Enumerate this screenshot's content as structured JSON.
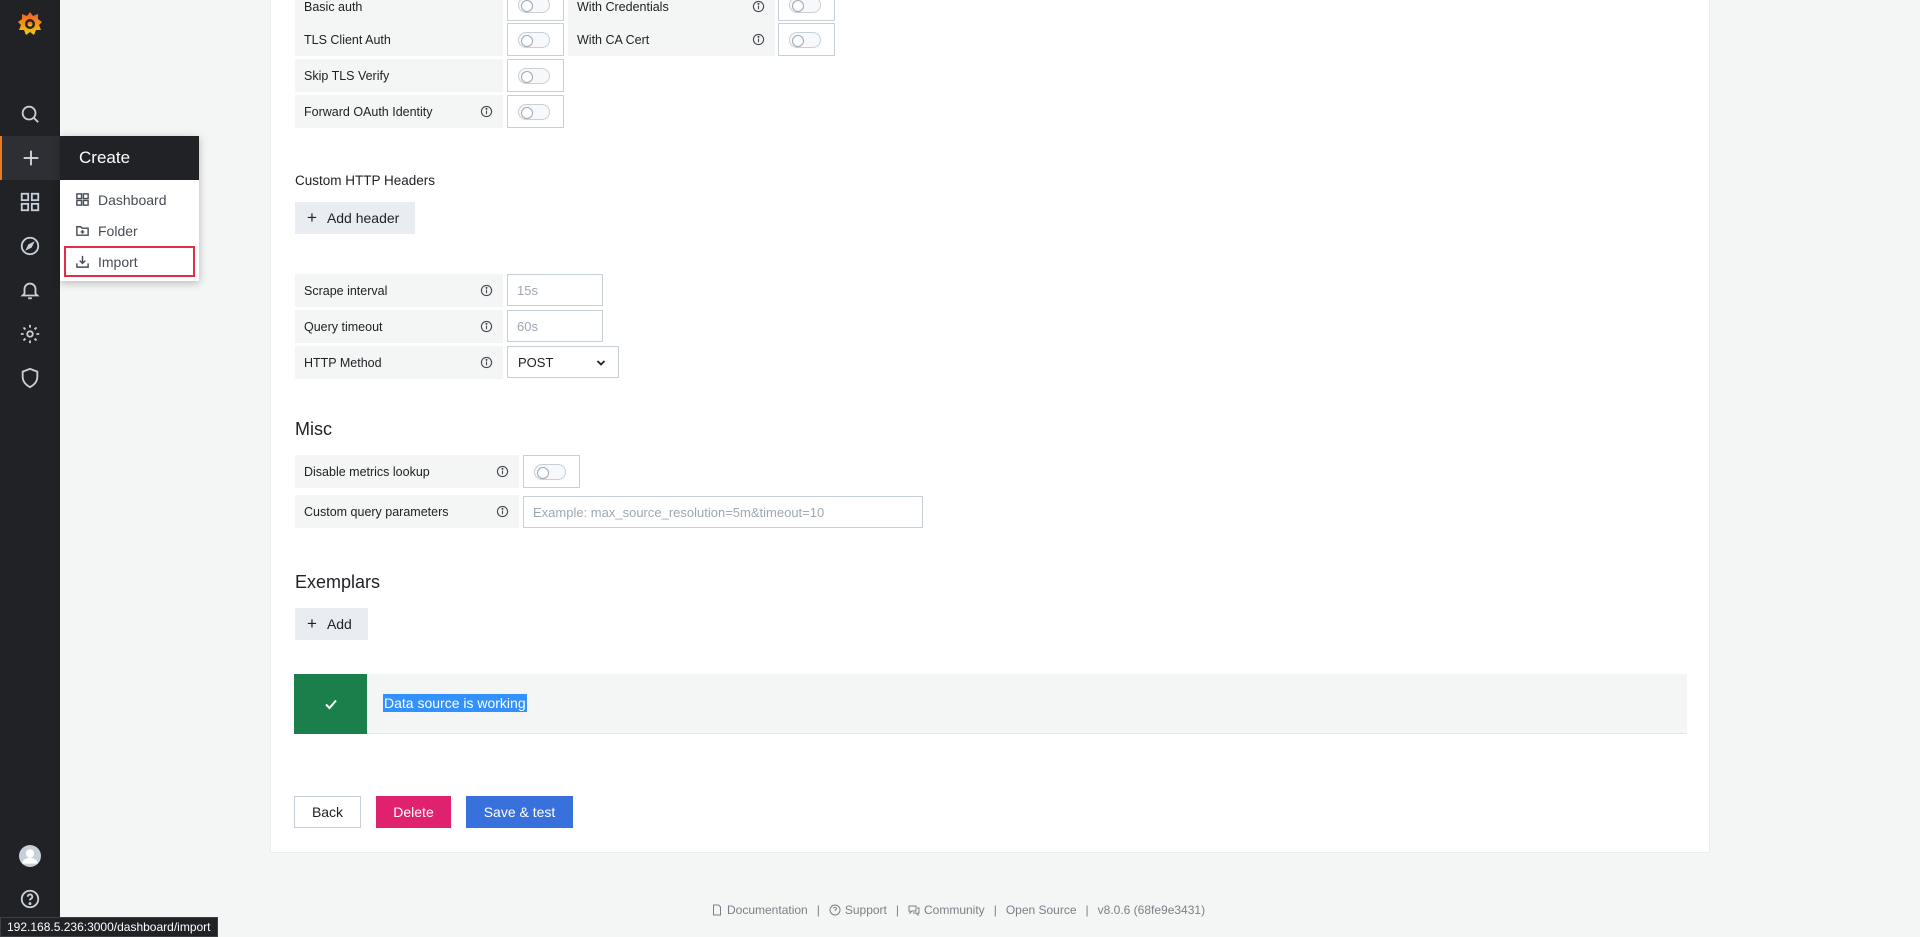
{
  "create_menu": {
    "title": "Create",
    "items": [
      {
        "label": "Dashboard",
        "icon": "apps-icon"
      },
      {
        "label": "Folder",
        "icon": "folder-plus-icon"
      },
      {
        "label": "Import",
        "icon": "import-icon"
      }
    ]
  },
  "auth": {
    "basic_auth": "Basic auth",
    "with_credentials": "With Credentials",
    "tls_client_auth": "TLS Client Auth",
    "with_ca_cert": "With CA Cert",
    "skip_tls_verify": "Skip TLS Verify",
    "forward_oauth": "Forward OAuth Identity"
  },
  "headers": {
    "title": "Custom HTTP Headers",
    "add_label": "Add header"
  },
  "prometheus": {
    "scrape_interval_label": "Scrape interval",
    "scrape_interval_placeholder": "15s",
    "query_timeout_label": "Query timeout",
    "query_timeout_placeholder": "60s",
    "http_method_label": "HTTP Method",
    "http_method_value": "POST"
  },
  "misc": {
    "title": "Misc",
    "disable_metrics_label": "Disable metrics lookup",
    "custom_query_label": "Custom query parameters",
    "custom_query_placeholder": "Example: max_source_resolution=5m&timeout=10"
  },
  "exemplars": {
    "title": "Exemplars",
    "add_label": "Add"
  },
  "alert": {
    "message": "Data source is working"
  },
  "actions": {
    "back": "Back",
    "delete": "Delete",
    "save": "Save & test"
  },
  "footer": {
    "documentation": "Documentation",
    "support": "Support",
    "community": "Community",
    "open_source": "Open Source",
    "version": "v8.0.6 (68fe9e3431)"
  },
  "status_bar": {
    "url": "192.168.5.236:3000/dashboard/import"
  },
  "colors": {
    "sidebar_bg": "#202226",
    "accent_orange": "#eb7b18",
    "success_green": "#1a7f4b",
    "delete_pink": "#e0226e",
    "primary_blue": "#3871dc"
  }
}
